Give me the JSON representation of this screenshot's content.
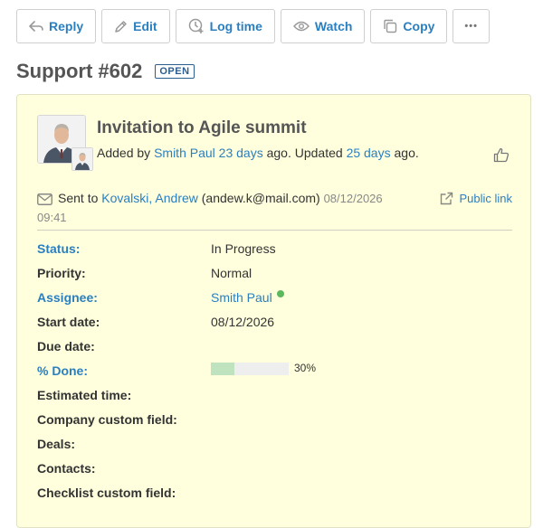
{
  "toolbar": {
    "reply": "Reply",
    "edit": "Edit",
    "log_time": "Log time",
    "watch": "Watch",
    "copy": "Copy",
    "more": "•••"
  },
  "issue": {
    "title": "Support #602",
    "status_tag": "OPEN",
    "subject": "Invitation to Agile summit",
    "added_prefix": "Added by ",
    "author": "Smith Paul",
    "created_ago": "23 days",
    "updated_mid": " ago. Updated ",
    "updated_ago": "25 days",
    "updated_suffix": " ago."
  },
  "email": {
    "prefix": "Sent to ",
    "contact": "Kovalski, Andrew",
    "address": " (andew.k@mail.com) ",
    "date": "08/12/2026",
    "time": "09:41",
    "public_link": "Public link"
  },
  "attributes": [
    {
      "label": "Status:",
      "value": "In Progress"
    },
    {
      "label": "Priority:",
      "value": "Normal"
    },
    {
      "label": "Assignee:",
      "value": "Smith Paul"
    },
    {
      "label": "Start date:",
      "value": "08/12/2026"
    },
    {
      "label": "Due date:",
      "value": ""
    },
    {
      "label": "% Done:",
      "value": "30%"
    },
    {
      "label": "Estimated time:",
      "value": ""
    },
    {
      "label": "Company custom field:",
      "value": ""
    },
    {
      "label": "Deals:",
      "value": ""
    },
    {
      "label": "Contacts:",
      "value": ""
    },
    {
      "label": "Checklist custom field:",
      "value": ""
    }
  ],
  "progress": {
    "done_fraction": 0.3
  },
  "icons": {
    "reply": "reply-icon",
    "edit": "pencil-icon",
    "log_time": "clock-plus-icon",
    "watch": "eye-icon",
    "copy": "copy-icon",
    "mail": "envelope-icon",
    "public_link": "external-link-icon",
    "like": "thumbs-up-icon"
  },
  "colors": {
    "link": "#2a7fc1",
    "card_bg": "#ffffdd",
    "status_tag": "#2c5d8f",
    "online": "#5cb85c",
    "progress_fill": "#bfe2bf"
  }
}
